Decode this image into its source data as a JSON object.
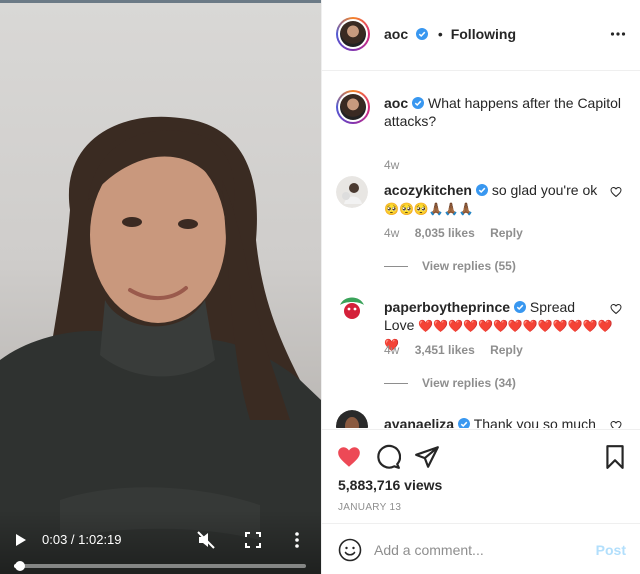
{
  "video": {
    "time": "0:03 / 1:02:19",
    "progress": 0.02,
    "icons": {
      "play": "play-icon",
      "mute": "muted-speaker-icon",
      "fullscreen": "fullscreen-icon",
      "more": "more-vertical-icon"
    }
  },
  "header": {
    "username": "aoc",
    "dot": "•",
    "follow_status": "Following",
    "more_icon": "more-horizontal-icon"
  },
  "caption": {
    "username": "aoc",
    "text": "What happens after the Capitol attacks?",
    "age": "4w"
  },
  "comments": [
    {
      "username": "acozykitchen",
      "text": "so glad you're ok",
      "emoji_line": "🥺🥺🥺🙏🏾🙏🏾🙏🏾",
      "age": "4w",
      "likes": "8,035 likes",
      "reply": "Reply",
      "view_replies": "View replies (55)"
    },
    {
      "username": "paperboytheprince",
      "text": "Spread",
      "text2": "Love",
      "emoji_line": "❤️❤️❤️❤️❤️❤️❤️❤️❤️❤️❤️❤️❤️❤️",
      "age": "4w",
      "likes": "3,451 likes",
      "reply": "Reply",
      "view_replies": "View replies (34)"
    },
    {
      "username": "ayanaeliza",
      "text": "Thank you so much"
    }
  ],
  "actions": {
    "liked": true,
    "views": "5,883,716 views",
    "date": "JANUARY 13"
  },
  "add_comment": {
    "placeholder": "Add a comment...",
    "post_label": "Post"
  },
  "colors": {
    "like": "#ed4956",
    "verified": "#3897f0",
    "post_disabled": "#b2dffc",
    "muted_text": "#8e8e8e"
  }
}
